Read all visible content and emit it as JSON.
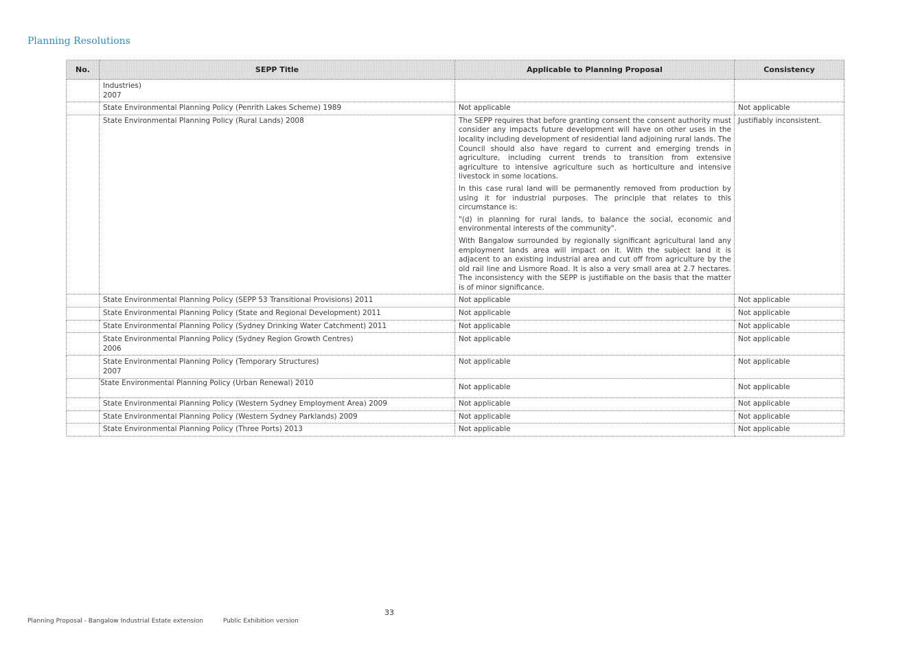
{
  "page": {
    "heading": "Planning Resolutions",
    "page_number": "33",
    "footer_left": "Planning Proposal - Bangalow Industrial Estate extension",
    "footer_right": "Public Exhibition version"
  },
  "table": {
    "headers": {
      "no": "No.",
      "title": "SEPP Title",
      "applicable": "Applicable to Planning Proposal",
      "consistency": "Consistency"
    },
    "rows": [
      {
        "no": "",
        "title_lines": [
          "Industries)",
          "2007"
        ],
        "applicable": "",
        "consistency": ""
      },
      {
        "no": "",
        "title_lines": [
          "State Environmental Planning Policy (Penrith Lakes Scheme) 1989"
        ],
        "applicable": "Not applicable",
        "consistency": "Not applicable"
      },
      {
        "no": "",
        "title_lines": [
          "State Environmental Planning Policy (Rural Lands) 2008"
        ],
        "applicable_paragraphs": [
          "The SEPP requires that before granting consent the consent authority must consider any impacts future development will have on other uses in the locality including development of residential land adjoining rural lands.  The Council should also have regard to current and emerging trends in agriculture, including current trends to transition from extensive agriculture to intensive agriculture such as horticulture and intensive livestock in some locations.",
          "In this case rural land will be permanently removed from production by using it for industrial purposes. The principle that relates to this circumstance is:",
          "\"(d) in planning for rural lands, to balance the social, economic and environmental interests of the community\".",
          "With Bangalow surrounded by regionally significant agricultural land any employment lands area will impact on it. With the subject land it is adjacent to an existing industrial area and cut off from agriculture by the old rail line and Lismore Road. It is also a very small area at 2.7 hectares. The inconsistency with the SEPP is justifiable on the basis that the matter is of minor significance."
        ],
        "consistency": "Justifiably inconsistent."
      },
      {
        "no": "",
        "title_lines": [
          "State Environmental Planning Policy (SEPP 53 Transitional Provisions) 2011"
        ],
        "applicable": "Not applicable",
        "consistency": "Not applicable"
      },
      {
        "no": "",
        "title_lines": [
          "State Environmental Planning Policy (State and Regional Development) 2011"
        ],
        "applicable": "Not applicable",
        "consistency": "Not applicable"
      },
      {
        "no": "",
        "title_lines": [
          "State Environmental Planning Policy (Sydney Drinking Water Catchment) 2011"
        ],
        "applicable": "Not applicable",
        "consistency": "Not applicable"
      },
      {
        "no": "",
        "title_lines": [
          "State Environmental Planning Policy (Sydney Region Growth Centres)",
          "2006"
        ],
        "applicable": "Not applicable",
        "consistency": "Not applicable"
      },
      {
        "no": "",
        "title_lines": [
          "State Environmental Planning Policy (Temporary Structures)",
          "2007"
        ],
        "applicable": "Not applicable",
        "consistency": "Not applicable"
      },
      {
        "no": "",
        "title_lines": [
          "State Environmental Planning Policy (Urban Renewal) 2010"
        ],
        "applicable": "Not applicable",
        "consistency": "Not applicable"
      },
      {
        "no": "",
        "title_lines": [
          "State Environmental Planning Policy (Western Sydney Employment Area) 2009"
        ],
        "applicable": "Not applicable",
        "consistency": "Not applicable"
      },
      {
        "no": "",
        "title_lines": [
          "State Environmental Planning Policy (Western Sydney Parklands) 2009"
        ],
        "applicable": "Not applicable",
        "consistency": "Not applicable"
      },
      {
        "no": "",
        "title_lines": [
          "State Environmental Planning Policy (Three Ports) 2013"
        ],
        "applicable": "Not applicable",
        "consistency": "Not applicable"
      }
    ]
  }
}
